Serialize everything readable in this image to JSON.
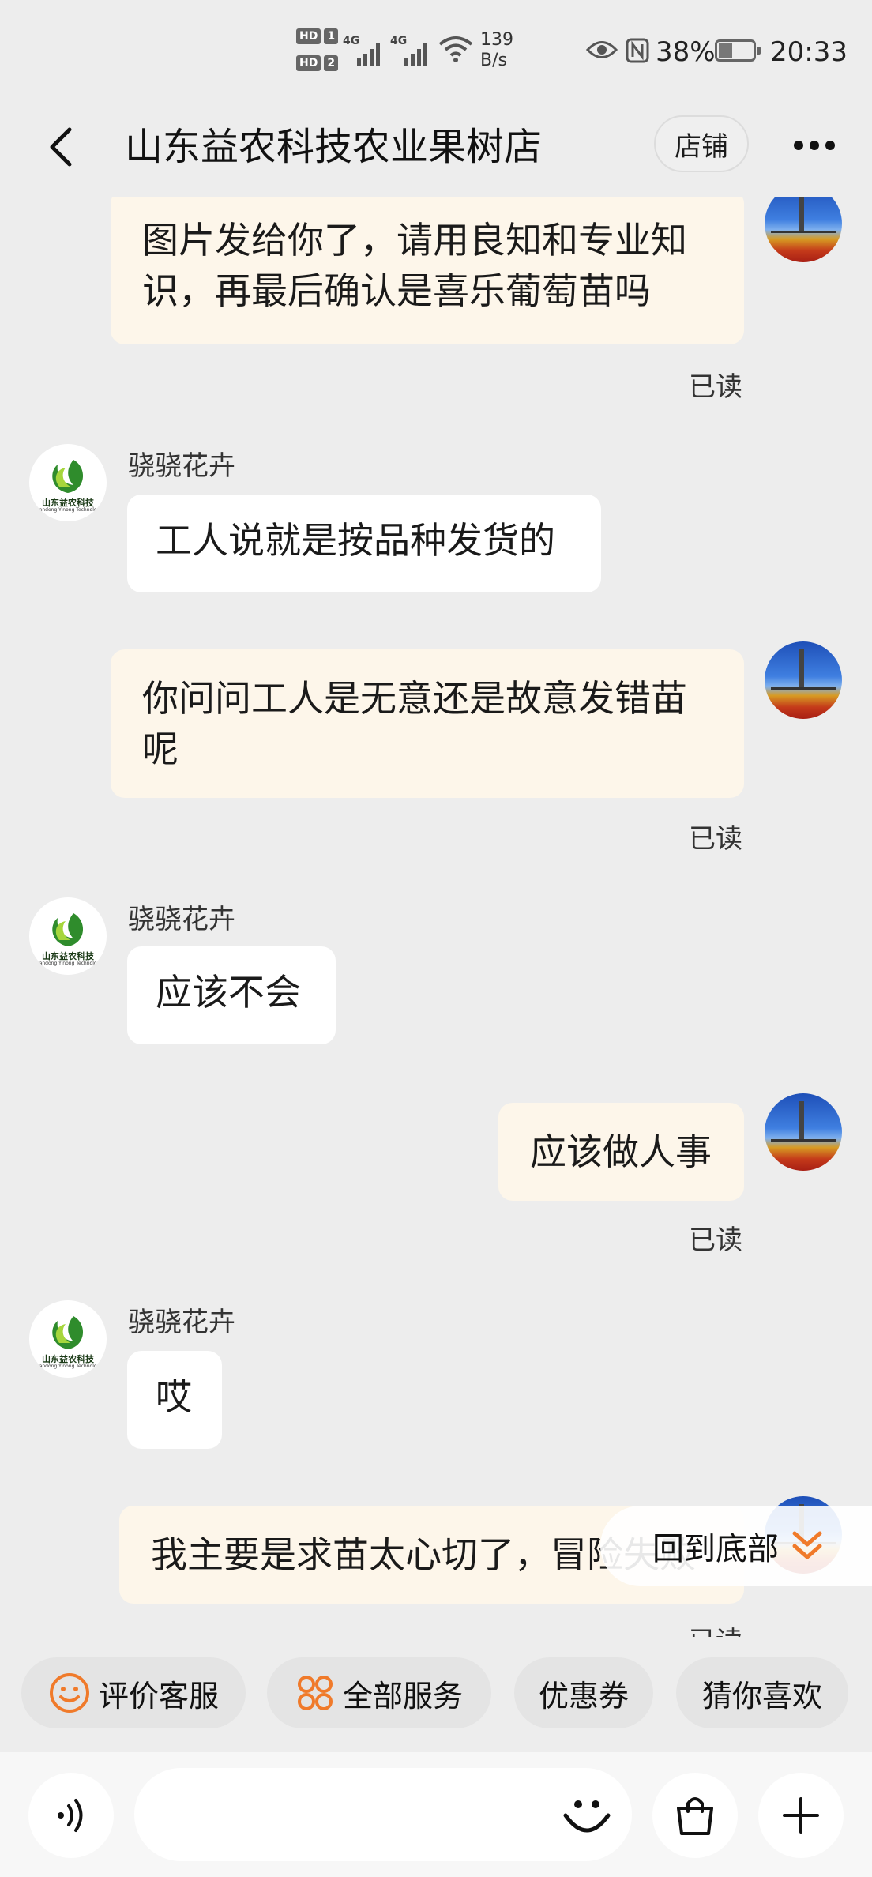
{
  "status_bar": {
    "hd1": "HD",
    "hd1_num": "1",
    "hd2": "HD",
    "hd2_num": "2",
    "net1": "4G",
    "net2": "4G",
    "speed_value": "139",
    "speed_unit": "B/s",
    "battery": "38%",
    "battery_level": 0.38,
    "time": "20:33"
  },
  "nav": {
    "title": "山东益农科技农业果树店",
    "shop_label": "店铺"
  },
  "shop_logo": {
    "text": "山东益农科技",
    "subtext": "Shandong Yinong Technology"
  },
  "messages": [
    {
      "from": "me",
      "text": "图片发给你了，请用良知和专业知识，再最后确认是喜乐葡萄苗吗",
      "status": "已读"
    },
    {
      "from": "shop",
      "sender": "骁骁花卉",
      "text": "工人说就是按品种发货的"
    },
    {
      "from": "me",
      "text": "你问问工人是无意还是故意发错苗呢",
      "status": "已读"
    },
    {
      "from": "shop",
      "sender": "骁骁花卉",
      "text": "应该不会"
    },
    {
      "from": "me",
      "text": "应该做人事",
      "status": "已读"
    },
    {
      "from": "shop",
      "sender": "骁骁花卉",
      "text": "哎"
    },
    {
      "from": "me",
      "text": "我主要是求苗太心切了，冒险失败",
      "status": "已读"
    }
  ],
  "scroll_to_bottom": "回到底部",
  "quick_actions": [
    {
      "label": "评价客服",
      "icon": "smiley-icon"
    },
    {
      "label": "全部服务",
      "icon": "grid-icon"
    },
    {
      "label": "优惠券"
    },
    {
      "label": "猜你喜欢"
    }
  ],
  "input": {
    "placeholder": ""
  },
  "colors": {
    "accent": "#f07a2a",
    "out_bubble": "#fdf6ea",
    "in_bubble": "#ffffff",
    "background": "#ededed"
  }
}
